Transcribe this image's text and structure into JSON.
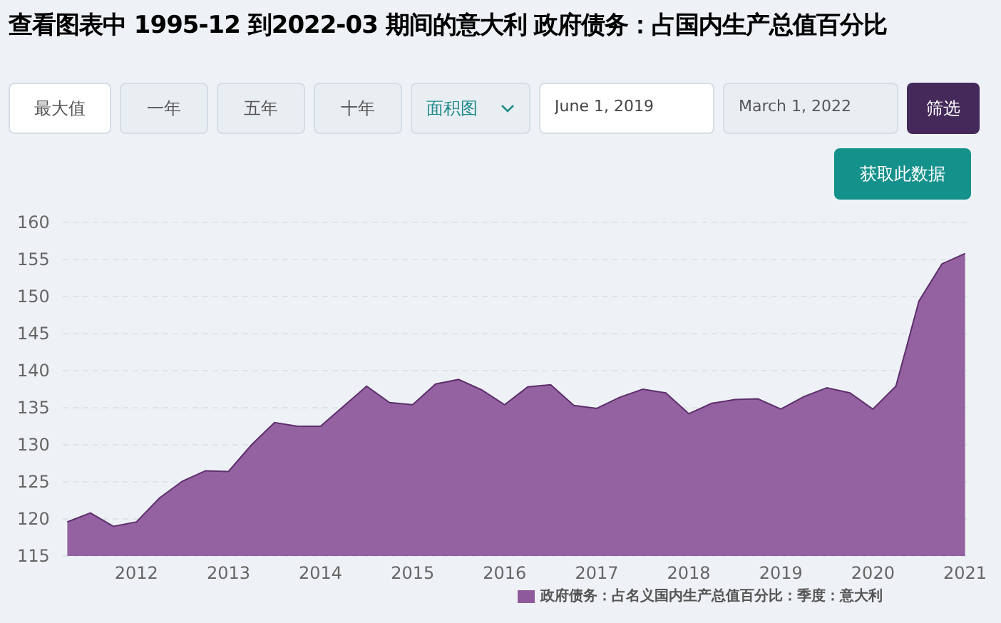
{
  "title": "查看图表中 1995-12 到2022-03 期间的意大利 政府债务：占国内生产总值百分比",
  "range_buttons": [
    {
      "label": "最大值",
      "selected": true
    },
    {
      "label": "一年",
      "selected": false
    },
    {
      "label": "五年",
      "selected": false
    },
    {
      "label": "十年",
      "selected": false
    }
  ],
  "chart_type_select": {
    "value": "面积图"
  },
  "start_date": {
    "value": "June 1, 2019"
  },
  "end_date": {
    "value": "March 1, 2022"
  },
  "filter_button": "筛选",
  "download_button": "获取此数据",
  "chart": {
    "chart_data": {
      "type": "area",
      "x": [
        2011.25,
        2011.5,
        2011.75,
        2012,
        2012.25,
        2012.5,
        2012.75,
        2013,
        2013.25,
        2013.5,
        2013.75,
        2014,
        2014.25,
        2014.5,
        2014.75,
        2015,
        2015.25,
        2015.5,
        2015.75,
        2016,
        2016.25,
        2016.5,
        2016.75,
        2017,
        2017.25,
        2017.5,
        2017.75,
        2018,
        2018.25,
        2018.5,
        2018.75,
        2019,
        2019.25,
        2019.5,
        2019.75,
        2020,
        2020.25,
        2020.5,
        2020.75,
        2021
      ],
      "series": [
        {
          "name": "政府债务：占名义国内生产总值百分比：季度：意大利",
          "color": "#8e5a9c",
          "values": [
            119.6,
            120.8,
            119.0,
            119.6,
            122.8,
            125.1,
            126.5,
            126.4,
            130.0,
            133.0,
            132.5,
            132.5,
            135.2,
            137.9,
            135.7,
            135.4,
            138.2,
            138.8,
            137.4,
            135.4,
            137.8,
            138.1,
            135.3,
            134.9,
            136.4,
            137.5,
            137.0,
            134.2,
            135.6,
            136.1,
            136.2,
            134.8,
            136.5,
            137.7,
            137.0,
            134.8,
            137.9,
            149.4,
            154.4,
            155.8
          ]
        }
      ],
      "xlim": [
        2011.2,
        2021.05
      ],
      "ylim": [
        115,
        160
      ],
      "xticks": [
        2012,
        2013,
        2014,
        2015,
        2016,
        2017,
        2018,
        2019,
        2020,
        2021
      ],
      "yticks": [
        115,
        120,
        125,
        130,
        135,
        140,
        145,
        150,
        155,
        160
      ],
      "grid": true
    }
  }
}
